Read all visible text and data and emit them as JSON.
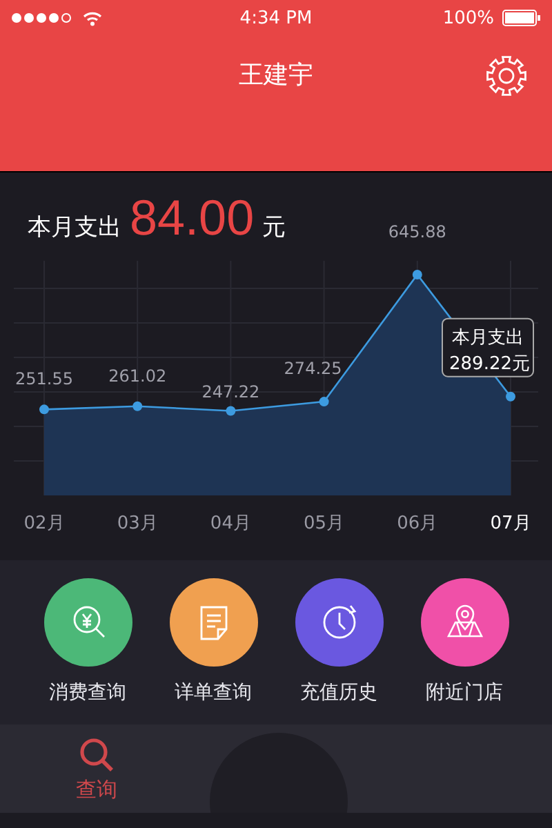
{
  "status_bar": {
    "time": "4:34 PM",
    "battery": "100%"
  },
  "header": {
    "title": "王建宇"
  },
  "summary": {
    "label": "本月支出",
    "amount": "84.00",
    "unit": "元"
  },
  "chart": {
    "tooltip": {
      "title": "本月支出",
      "unit": "元"
    },
    "chart_data": {
      "type": "area",
      "categories": [
        "02月",
        "03月",
        "04月",
        "05月",
        "06月",
        "07月"
      ],
      "series": [
        {
          "color": "#3d9be0",
          "values": [
            251.55,
            261.02,
            247.22,
            274.25,
            645.88,
            289.22
          ]
        }
      ],
      "data_labels": true,
      "grid": true
    }
  },
  "menu": [
    {
      "label": "消费查询",
      "color": "#4cb878",
      "kind": "search"
    },
    {
      "label": "详单查询",
      "color": "#f0a050",
      "kind": "note"
    },
    {
      "label": "充值历史",
      "color": "#6a58e0",
      "kind": "clock"
    },
    {
      "label": "附近门店",
      "color": "#f050a8",
      "kind": "map"
    }
  ],
  "tab_bar": [
    {
      "label": "查询",
      "selected": true
    }
  ]
}
